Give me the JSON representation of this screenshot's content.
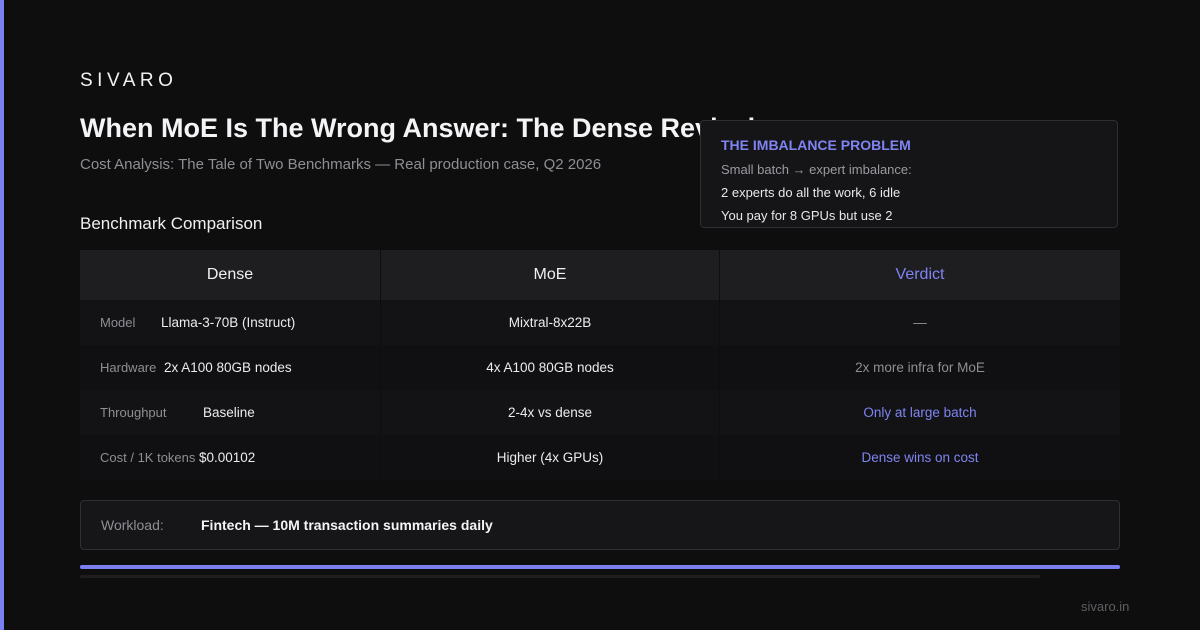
{
  "brand": "SIVARO",
  "title": "When MoE Is The Wrong Answer: The Dense Revival",
  "subtitle": "Cost Analysis: The Tale of Two Benchmarks — Real production case, Q2 2026",
  "section_heading": "Benchmark Comparison",
  "callout": {
    "title": "THE IMBALANCE PROBLEM",
    "line1": "Small batch → expert imbalance:",
    "line2": "2 experts do all the work, 6 idle",
    "line3": "You pay for 8 GPUs but use 2"
  },
  "table": {
    "headers": [
      "Dense",
      "MoE",
      "Verdict"
    ],
    "rows": [
      {
        "label": "Model",
        "dense": "Llama-3-70B (Instruct)",
        "moe": "Mixtral-8x22B",
        "verdict": "—",
        "accent": false
      },
      {
        "label": "Hardware",
        "dense": "2x A100 80GB nodes",
        "moe": "4x A100 80GB nodes",
        "verdict": "2x more infra for MoE",
        "accent": false
      },
      {
        "label": "Throughput",
        "dense": "Baseline",
        "moe": "2-4x vs dense",
        "verdict": "Only at large batch",
        "accent": true
      },
      {
        "label": "Cost / 1K tokens",
        "dense": "$0.00102",
        "moe": "Higher (4x GPUs)",
        "verdict": "Dense wins on cost",
        "accent": true
      }
    ]
  },
  "workload": {
    "label": "Workload:",
    "value": "Fintech — 10M transaction summaries daily"
  },
  "progress": 1.0,
  "footer": "sivaro.in",
  "colors": {
    "accent": "#7a80f0",
    "background": "#0e0e0f"
  }
}
